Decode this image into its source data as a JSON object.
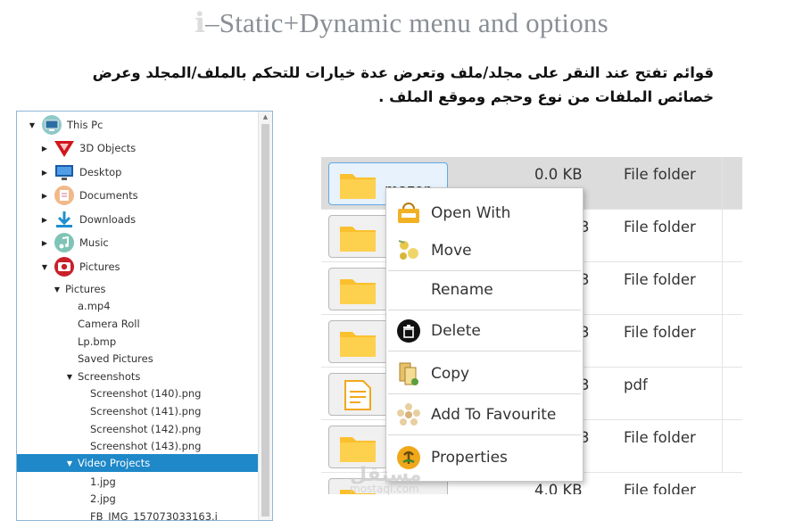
{
  "header": {
    "title_prefix": "ℹ",
    "title": "–Static+Dynamic menu and options",
    "description": "قوائم تفتح عند النقر على مجلد/ملف وتعرض عدة خيارات للتحكم بالملف/المجلد وعرض خصائص الملفات من نوع وحجم وموقع الملف ."
  },
  "tree": {
    "root": "This Pc",
    "items": [
      {
        "label": "3D Objects"
      },
      {
        "label": "Desktop"
      },
      {
        "label": "Documents"
      },
      {
        "label": "Downloads"
      },
      {
        "label": "Music"
      },
      {
        "label": "Pictures"
      }
    ],
    "children": [
      {
        "label": "Pictures"
      },
      {
        "label": "a.mp4"
      },
      {
        "label": "Camera Roll"
      },
      {
        "label": "Lp.bmp"
      },
      {
        "label": "Saved Pictures"
      },
      {
        "label": "Screenshots"
      },
      {
        "label": "Screenshot (140).png"
      },
      {
        "label": "Screenshot (141).png"
      },
      {
        "label": "Screenshot (142).png"
      },
      {
        "label": "Screenshot (143).png"
      },
      {
        "label": "Video Projects"
      },
      {
        "label": "1.jpg"
      },
      {
        "label": "2.jpg"
      },
      {
        "label": "FB_IMG_157073033163.j"
      }
    ],
    "selected": "Video Projects"
  },
  "files": {
    "rows": [
      {
        "name": "mazen",
        "size": "0.0  KB",
        "type": "File folder",
        "icon": "folder-icon"
      },
      {
        "name": "",
        "size": "3",
        "type": "File folder",
        "icon": "folder-icon"
      },
      {
        "name": "",
        "size": "3",
        "type": "File folder",
        "icon": "folder-icon"
      },
      {
        "name": "",
        "size": "3",
        "type": "File folder",
        "icon": "folder-icon"
      },
      {
        "name": "",
        "size": "3",
        "type": "pdf",
        "icon": "document-icon"
      },
      {
        "name": "",
        "size": "3",
        "type": "File folder",
        "icon": "folder-icon"
      },
      {
        "name": "",
        "size": "4.0  KB",
        "type": "File folder",
        "icon": "folder-icon"
      }
    ]
  },
  "menu": {
    "items": [
      {
        "label": "Open With",
        "icon": "open-with-icon"
      },
      {
        "label": "Move",
        "icon": "move-icon"
      },
      {
        "label": "Rename",
        "icon": ""
      },
      {
        "label": "Delete",
        "icon": "delete-icon"
      },
      {
        "label": "Copy",
        "icon": "copy-icon"
      },
      {
        "label": "Add To Favourite",
        "icon": "favourite-icon"
      },
      {
        "label": "Properties",
        "icon": "properties-icon"
      }
    ]
  },
  "watermark": {
    "brand": "مستقل",
    "site": "mostaql.com"
  },
  "colors": {
    "selection": "#1e88c8",
    "folder": "#fbc02d",
    "tree_border": "#8fb6d8"
  }
}
